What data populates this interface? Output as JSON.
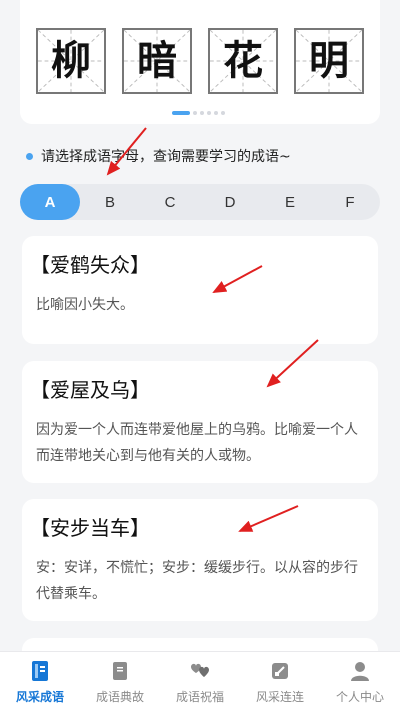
{
  "banner": {
    "characters": [
      "柳",
      "暗",
      "花",
      "明"
    ],
    "page_count": 6,
    "active_page": 1
  },
  "hint": {
    "text": "请选择成语字母，查询需要学习的成语~"
  },
  "letters": {
    "items": [
      "A",
      "B",
      "C",
      "D",
      "E",
      "F"
    ],
    "active": "A"
  },
  "idioms": [
    {
      "title": "【爱鹤失众】",
      "desc": "比喻因小失大。"
    },
    {
      "title": "【爱屋及乌】",
      "desc": "因为爱一个人而连带爱他屋上的乌鸦。比喻爱一个人而连带地关心到与他有关的人或物。"
    },
    {
      "title": "【安步当车】",
      "desc": "安：安详，不慌忙；安步：缓缓步行。以从容的步行代替乘车。"
    }
  ],
  "nav": {
    "items": [
      {
        "label": "风采成语",
        "icon": "book-icon",
        "active": true
      },
      {
        "label": "成语典故",
        "icon": "storybook-icon",
        "active": false
      },
      {
        "label": "成语祝福",
        "icon": "hearts-icon",
        "active": false
      },
      {
        "label": "风采连连",
        "icon": "link-square-icon",
        "active": false
      },
      {
        "label": "个人中心",
        "icon": "person-icon",
        "active": false
      }
    ]
  },
  "colors": {
    "accent": "#4aa3f0",
    "nav_active": "#1677d6",
    "arrow": "#e02020"
  }
}
